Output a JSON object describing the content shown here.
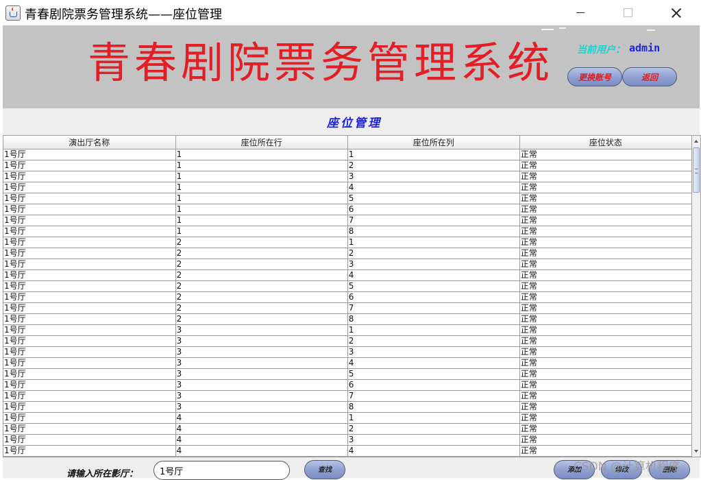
{
  "window": {
    "title": "青春剧院票务管理系统——座位管理"
  },
  "banner": {
    "title": "青春剧院票务管理系统",
    "user_label": "当前用户：",
    "user_name": "admin",
    "switch_account_label": "更换账号",
    "back_label": "返回"
  },
  "section": {
    "title": "座位管理"
  },
  "table": {
    "columns": [
      "演出厅名称",
      "座位所在行",
      "座位所在列",
      "座位状态"
    ],
    "rows": [
      [
        "1号厅",
        "1",
        "1",
        "正常"
      ],
      [
        "1号厅",
        "1",
        "2",
        "正常"
      ],
      [
        "1号厅",
        "1",
        "3",
        "正常"
      ],
      [
        "1号厅",
        "1",
        "4",
        "正常"
      ],
      [
        "1号厅",
        "1",
        "5",
        "正常"
      ],
      [
        "1号厅",
        "1",
        "6",
        "正常"
      ],
      [
        "1号厅",
        "1",
        "7",
        "正常"
      ],
      [
        "1号厅",
        "1",
        "8",
        "正常"
      ],
      [
        "1号厅",
        "2",
        "1",
        "正常"
      ],
      [
        "1号厅",
        "2",
        "2",
        "正常"
      ],
      [
        "1号厅",
        "2",
        "3",
        "正常"
      ],
      [
        "1号厅",
        "2",
        "4",
        "正常"
      ],
      [
        "1号厅",
        "2",
        "5",
        "正常"
      ],
      [
        "1号厅",
        "2",
        "6",
        "正常"
      ],
      [
        "1号厅",
        "2",
        "7",
        "正常"
      ],
      [
        "1号厅",
        "2",
        "8",
        "正常"
      ],
      [
        "1号厅",
        "3",
        "1",
        "正常"
      ],
      [
        "1号厅",
        "3",
        "2",
        "正常"
      ],
      [
        "1号厅",
        "3",
        "3",
        "正常"
      ],
      [
        "1号厅",
        "3",
        "4",
        "正常"
      ],
      [
        "1号厅",
        "3",
        "5",
        "正常"
      ],
      [
        "1号厅",
        "3",
        "6",
        "正常"
      ],
      [
        "1号厅",
        "3",
        "7",
        "正常"
      ],
      [
        "1号厅",
        "3",
        "8",
        "正常"
      ],
      [
        "1号厅",
        "4",
        "1",
        "正常"
      ],
      [
        "1号厅",
        "4",
        "2",
        "正常"
      ],
      [
        "1号厅",
        "4",
        "3",
        "正常"
      ],
      [
        "1号厅",
        "4",
        "4",
        "正常"
      ]
    ]
  },
  "footer": {
    "search_label": "请输入所在影厅：",
    "search_value": "1号厅",
    "find_label": "查找",
    "add_label": "添加",
    "edit_label": "修改",
    "delete_label": "删除"
  },
  "watermark": "CSDN @计算机程序",
  "colors": {
    "banner_title": "#e21f26",
    "accent_blue": "#1f23d9",
    "user_label": "#16d6d1",
    "banner_bg": "#c3c3c3"
  }
}
